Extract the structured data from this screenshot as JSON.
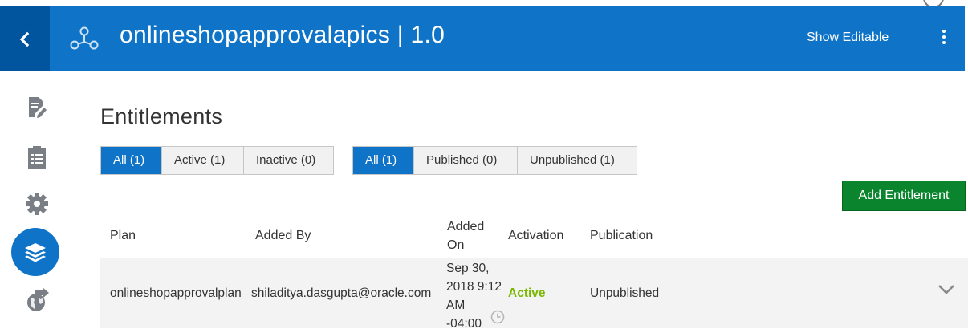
{
  "header": {
    "back_icon": "chevron-left-icon",
    "app_icon": "api-hub-icon",
    "title": "onlineshopapprovalapics | 1.0",
    "show_editable": "Show Editable",
    "more_icon": "kebab-menu-icon",
    "colors": {
      "bar": "#0f74c7",
      "back": "#00559e"
    }
  },
  "sidebar": {
    "items": [
      {
        "icon": "document-edit-icon",
        "active": false
      },
      {
        "icon": "clipboard-list-icon",
        "active": false
      },
      {
        "icon": "gear-icon",
        "active": false
      },
      {
        "icon": "layers-icon",
        "active": true
      },
      {
        "icon": "globe-arrow-icon",
        "active": false
      }
    ]
  },
  "main": {
    "title": "Entitlements",
    "status_filter": [
      "All (1)",
      "Active (1)",
      "Inactive (0)"
    ],
    "status_selected": "All (1)",
    "publish_filter": [
      "All (1)",
      "Published (0)",
      "Unpublished (1)"
    ],
    "publish_selected": "All (1)",
    "add_button": "Add Entitlement",
    "table": {
      "columns": {
        "plan": "Plan",
        "added_by": "Added By",
        "added_on_1": "Added",
        "added_on_2": "On",
        "activation": "Activation",
        "publication": "Publication"
      },
      "rows": [
        {
          "plan": "onlineshopapprovalplan",
          "added_by": "shiladitya.dasgupta@oracle.com",
          "added_on_lines": [
            "Sep 30,",
            "2018 9:12",
            "AM",
            "-04:00"
          ],
          "activation": "Active",
          "publication": "Unpublished"
        }
      ]
    },
    "colors": {
      "selected": "#0f74c7",
      "add_button": "#0a852e",
      "active_text": "#7ab800"
    }
  }
}
